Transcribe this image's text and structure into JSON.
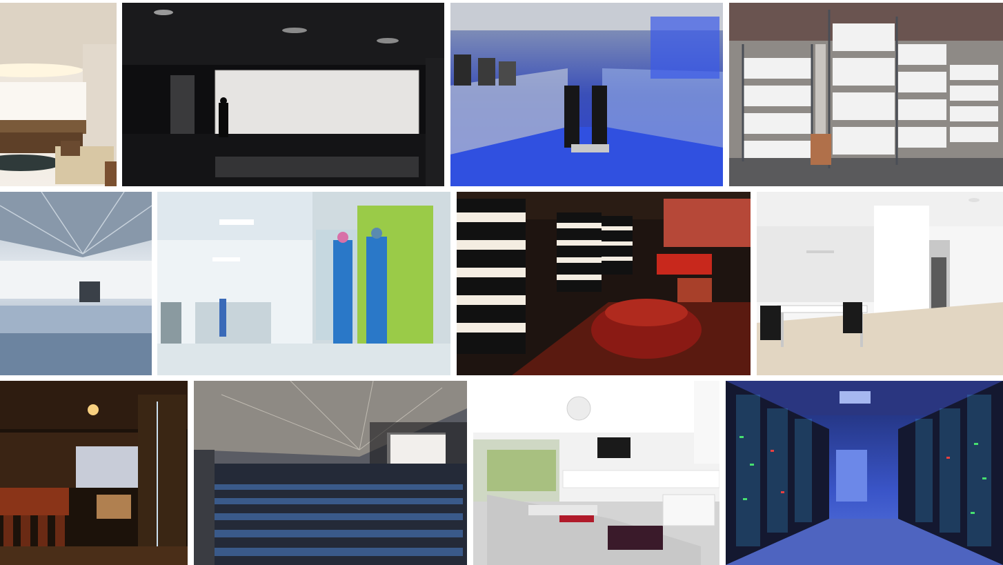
{
  "collage": {
    "photos": [
      {
        "id": "lounge-cove-lighting"
      },
      {
        "id": "backlit-wall-silhouette"
      },
      {
        "id": "airport-moving-walkway"
      },
      {
        "id": "warehouse-racks"
      },
      {
        "id": "terminal-hall-skylight"
      },
      {
        "id": "hospital-corridor-staff"
      },
      {
        "id": "red-lounge-striped-columns"
      },
      {
        "id": "white-office"
      },
      {
        "id": "bar-restaurant"
      },
      {
        "id": "auditorium"
      },
      {
        "id": "living-room"
      },
      {
        "id": "server-room"
      }
    ]
  },
  "colors": {
    "background": "#ffffff",
    "server_blue": "#3a55c8",
    "walkway_blue": "#2a3fd8",
    "lounge_red": "#8a1a14"
  }
}
